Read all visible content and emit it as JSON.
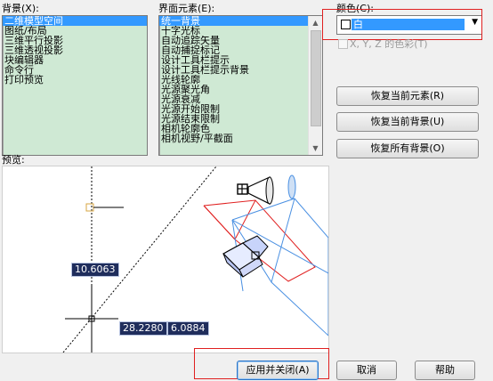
{
  "background": {
    "label": "背景(X):",
    "items": [
      "二维模型空间",
      "图纸/布局",
      "三维平行投影",
      "三维透视投影",
      "块编辑器",
      "命令行",
      "打印预览"
    ],
    "selected_index": 0
  },
  "elements": {
    "label": "界面元素(E):",
    "items": [
      "统一背景",
      "十字光标",
      "自动追踪矢量",
      "自动捕捉标记",
      "设计工具栏提示",
      "设计工具栏提示背景",
      "光线轮廓",
      "光源聚光角",
      "光源衰减",
      "光源开始限制",
      "光源结束限制",
      "相机轮廓色",
      "相机视野/平截面"
    ],
    "selected_index": 0
  },
  "color": {
    "label": "颜色(C):",
    "value": "白",
    "swatch_color": "#ffffff",
    "tint_label": "X, Y, Z 的色彩(T)",
    "tint_checked": false
  },
  "buttons": {
    "restore_current_element": "恢复当前元素(R)",
    "restore_current_background": "恢复当前背景(U)",
    "restore_all_backgrounds": "恢复所有背景(O)",
    "apply_and_close": "应用并关闭(A)",
    "cancel": "取消",
    "help": "帮助"
  },
  "preview": {
    "label": "预览:",
    "coord_1": "10.6063",
    "coord_2": "28.2280",
    "coord_3": "6.0884"
  },
  "colors": {
    "accent": "#3399ff",
    "list_background": "#cfe9d4",
    "highlight_box": "#e02020",
    "coord_box": "#1f2d5c"
  }
}
